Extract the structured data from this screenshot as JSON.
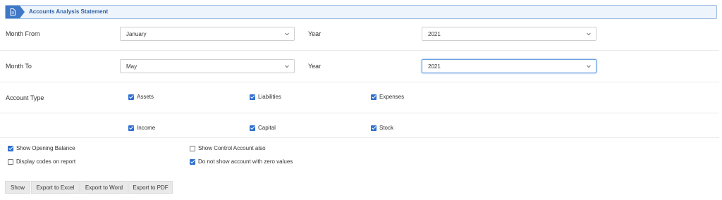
{
  "header": {
    "title": "Accounts Analysis Statement",
    "icon": "document-icon",
    "accent": "#3f78c6"
  },
  "form": {
    "month_from": {
      "label": "Month From",
      "value": "January"
    },
    "year_from": {
      "label": "Year",
      "value": "2021"
    },
    "month_to": {
      "label": "Month To",
      "value": "May"
    },
    "year_to": {
      "label": "Year",
      "value": "2021"
    },
    "account_type": {
      "label": "Account Type",
      "options": [
        {
          "label": "Assets",
          "checked": true
        },
        {
          "label": "Liabilities",
          "checked": true
        },
        {
          "label": "Expenses",
          "checked": true
        },
        {
          "label": "Income",
          "checked": true
        },
        {
          "label": "Capital",
          "checked": true
        },
        {
          "label": "Stock",
          "checked": true
        }
      ]
    },
    "options": {
      "show_opening_balance": {
        "label": "Show Opening Balance",
        "checked": true
      },
      "display_codes": {
        "label": "Display codes on report",
        "checked": false
      },
      "show_control_account": {
        "label": "Show Control Account also",
        "checked": false
      },
      "hide_zero": {
        "label": "Do not show account with zero values",
        "checked": true
      }
    }
  },
  "buttons": {
    "show": "Show",
    "excel": "Export to Excel",
    "word": "Export to Word",
    "pdf": "Export to PDF"
  }
}
